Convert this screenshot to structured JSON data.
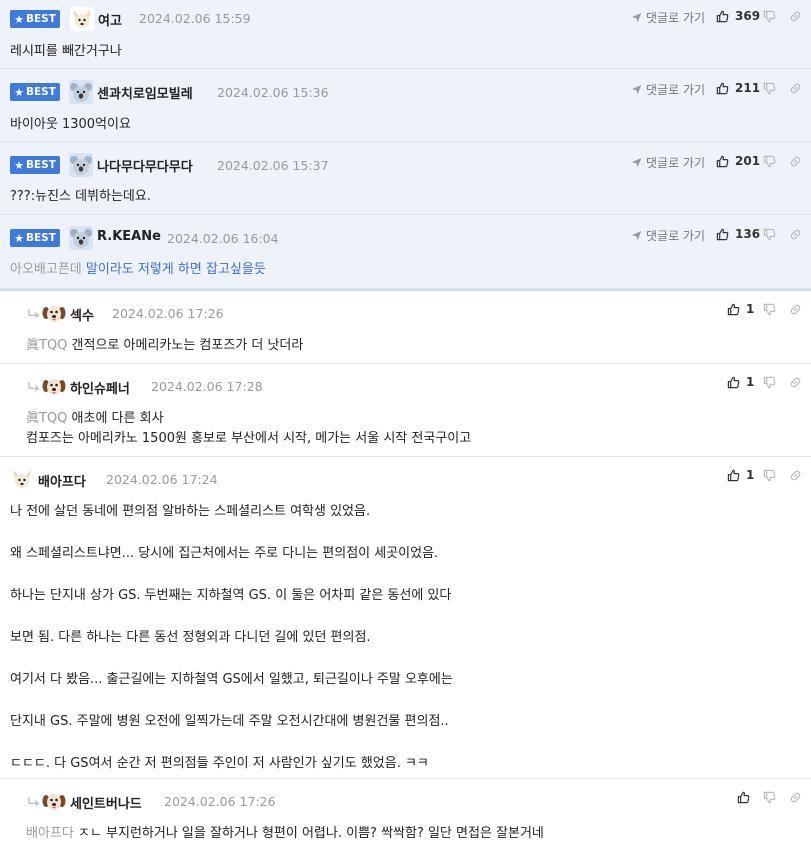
{
  "ui": {
    "best_label": "BEST",
    "goto_label": "댓글로 가기"
  },
  "colors": {
    "best_bg": "#eef3fb",
    "badge": "#3e7ad8",
    "mention": "#3e6ecf"
  },
  "comments": [
    {
      "nick": "여고",
      "date": "2024.02.06 15:59",
      "text": "레시피를 빼간거구나",
      "likes": "369",
      "best": true
    },
    {
      "nick": "센과치로임모빌레",
      "date": "2024.02.06 15:36",
      "text": "바이아웃 1300억이요",
      "likes": "211",
      "best": true
    },
    {
      "nick": "나다무다무다무다",
      "date": "2024.02.06 15:37",
      "text": "???:뉴진스 데뷔하는데요.",
      "likes": "201",
      "best": true
    },
    {
      "nick": "R.KEANe",
      "date": "2024.02.06 16:04",
      "tag": "아오배고픈데",
      "text": "말이라도 저렇게 하면 잡고싶을듯",
      "likes": "136",
      "best": true
    },
    {
      "nick": "섹수",
      "date": "2024.02.06 17:26",
      "tag": "眞TQQ",
      "text": "갠적으로 아메리카노는 컴포즈가 더 낫더라",
      "likes": "1"
    },
    {
      "nick": "하인슈페너",
      "date": "2024.02.06 17:28",
      "tag": "眞TQQ",
      "text": "애초에 다른 회사",
      "text2": "컴포즈는 아메리카노 1500원 홍보로 부산에서 시작, 메가는 서울 시작 전국구이고",
      "likes": "1"
    },
    {
      "nick": "배아프다",
      "date": "2024.02.06 17:24",
      "likes": "1",
      "lines": [
        "나 전에 살던 동네에 편의점 알바하는 스페셜리스트 여학생 있었음.",
        "왜 스페셜리스트냐면... 당시에 집근처에서는 주로 다니는 편의점이 세곳이었음.",
        "하나는 단지내 상가 GS. 두번째는 지하철역 GS. 이 둘은 어차피 같은 동선에 있다",
        "보면 됨. 다른 하나는 다른 동선 정형외과 다니던 길에 있던 편의점.",
        "여기서 다 봤음... 출근길에는 지하철역 GS에서 일했고, 퇴근길이나 주말 오후에는",
        "단지내 GS. 주말에 병원 오전에 일찍가는데 주말 오전시간대에 병원건물 편의점..",
        "ㄷㄷㄷ. 다 GS여서 순간 저 편의점들 주인이 저 사람인가 싶기도 했었음. ㅋㅋ"
      ]
    },
    {
      "nick": "세인트버나드",
      "date": "2024.02.06 17:26",
      "tag": "배아프다",
      "text": "ㅈㄴ 부지런하거나 일을 잘하거나 형편이 어렵나. 이쁨? 싹싹함? 일단 면접은 잘본거네"
    }
  ]
}
